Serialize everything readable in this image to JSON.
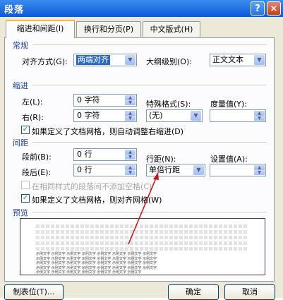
{
  "window": {
    "title": "段落",
    "help": "?",
    "close": "×"
  },
  "tabs": [
    {
      "label": "缩进和间距(I)",
      "active": true
    },
    {
      "label": "换行和分页(P)",
      "active": false
    },
    {
      "label": "中文版式(H)",
      "active": false
    }
  ],
  "general": {
    "heading": "常规",
    "alignment_label": "对齐方式(G):",
    "alignment_value": "两端对齐",
    "outline_label": "大纲级别(O):",
    "outline_value": "正文文本"
  },
  "indent": {
    "heading": "缩进",
    "left_label": "左(L):",
    "left_value": "0 字符",
    "right_label": "右(R):",
    "right_value": "0 字符",
    "special_label": "特殊格式(S):",
    "special_value": "(无)",
    "measure_label": "度量值(Y):",
    "measure_value": "",
    "grid_check_label": "如果定义了文档网格，则自动调整右缩进(D)",
    "grid_checked": true
  },
  "spacing": {
    "heading": "间距",
    "before_label": "段前(B):",
    "before_value": "0 行",
    "after_label": "段后(E):",
    "after_value": "0 行",
    "line_spacing_label": "行距(N):",
    "line_spacing_value": "单倍行距",
    "set_value_label": "设置值(A):",
    "set_value": "",
    "no_space_label": "在相同样式的段落间不添加空格(C)",
    "no_space_checked": false,
    "snap_grid_label": "如果定义了文档网格，则对齐网格(W)",
    "snap_grid_checked": true
  },
  "preview": {
    "heading": "预览",
    "sample_lines": [
      "示例文字 示例文字 示例文字 示例文字 示例文字 示例文字 示例文字 示例文字",
      "示例文字 示例文字 示例文字 示例文字 示例文字 示例文字 示例文字 示例文字",
      "示例文字 示例文字 示例文字 示例文字 示例文字 示例文字 示例文字 示例文字",
      "示例文字 示例文字 示例文字 示例文字 示例文字 示例文字 示例文字 示例文字",
      "示例文字 示例文字 示例文字 示例文字 示例文字 示例文字 示例文字"
    ]
  },
  "buttons": {
    "tabs": "制表位(T)...",
    "ok": "确定",
    "cancel": "取消"
  },
  "colors": {
    "titlebar": "#0c5ad8",
    "dialog": "#ece9d8",
    "section_heading": "#1a41a8",
    "annotation_arrow": "#d01010"
  }
}
